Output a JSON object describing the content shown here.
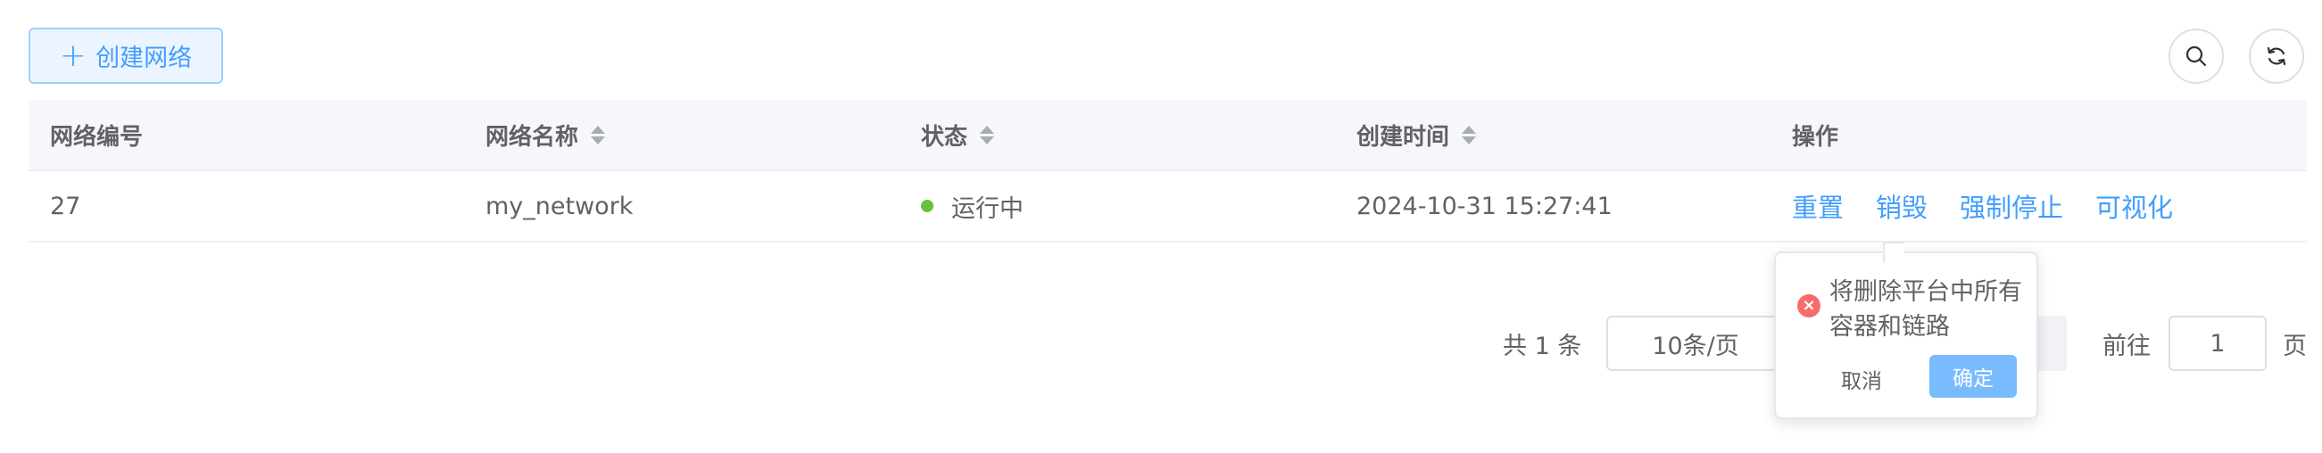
{
  "toolbar": {
    "create_label": "创建网络",
    "create_icon": "plus-icon",
    "search_icon": "search-icon",
    "refresh_icon": "refresh-icon"
  },
  "table": {
    "columns": [
      "网络编号",
      "网络名称",
      "状态",
      "创建时间",
      "操作"
    ],
    "rows": [
      {
        "id": "27",
        "name": "my_network",
        "status": "运行中",
        "created": "2024-10-31 15:27:41",
        "actions": [
          "重置",
          "销毁",
          "强制停止",
          "可视化"
        ]
      }
    ]
  },
  "pagination": {
    "total": "共 1 条",
    "page_size": "10条/页",
    "goto_label": "前往",
    "goto_value": "1",
    "page_label": "页"
  },
  "popconfirm": {
    "message": "将删除平台中所有容器和链路",
    "cancel_label": "取消",
    "confirm_label": "确定",
    "icon": "close-circle-icon"
  },
  "colors": {
    "primary": "#409eff",
    "success": "#67c23a",
    "danger": "#f56c6c"
  }
}
